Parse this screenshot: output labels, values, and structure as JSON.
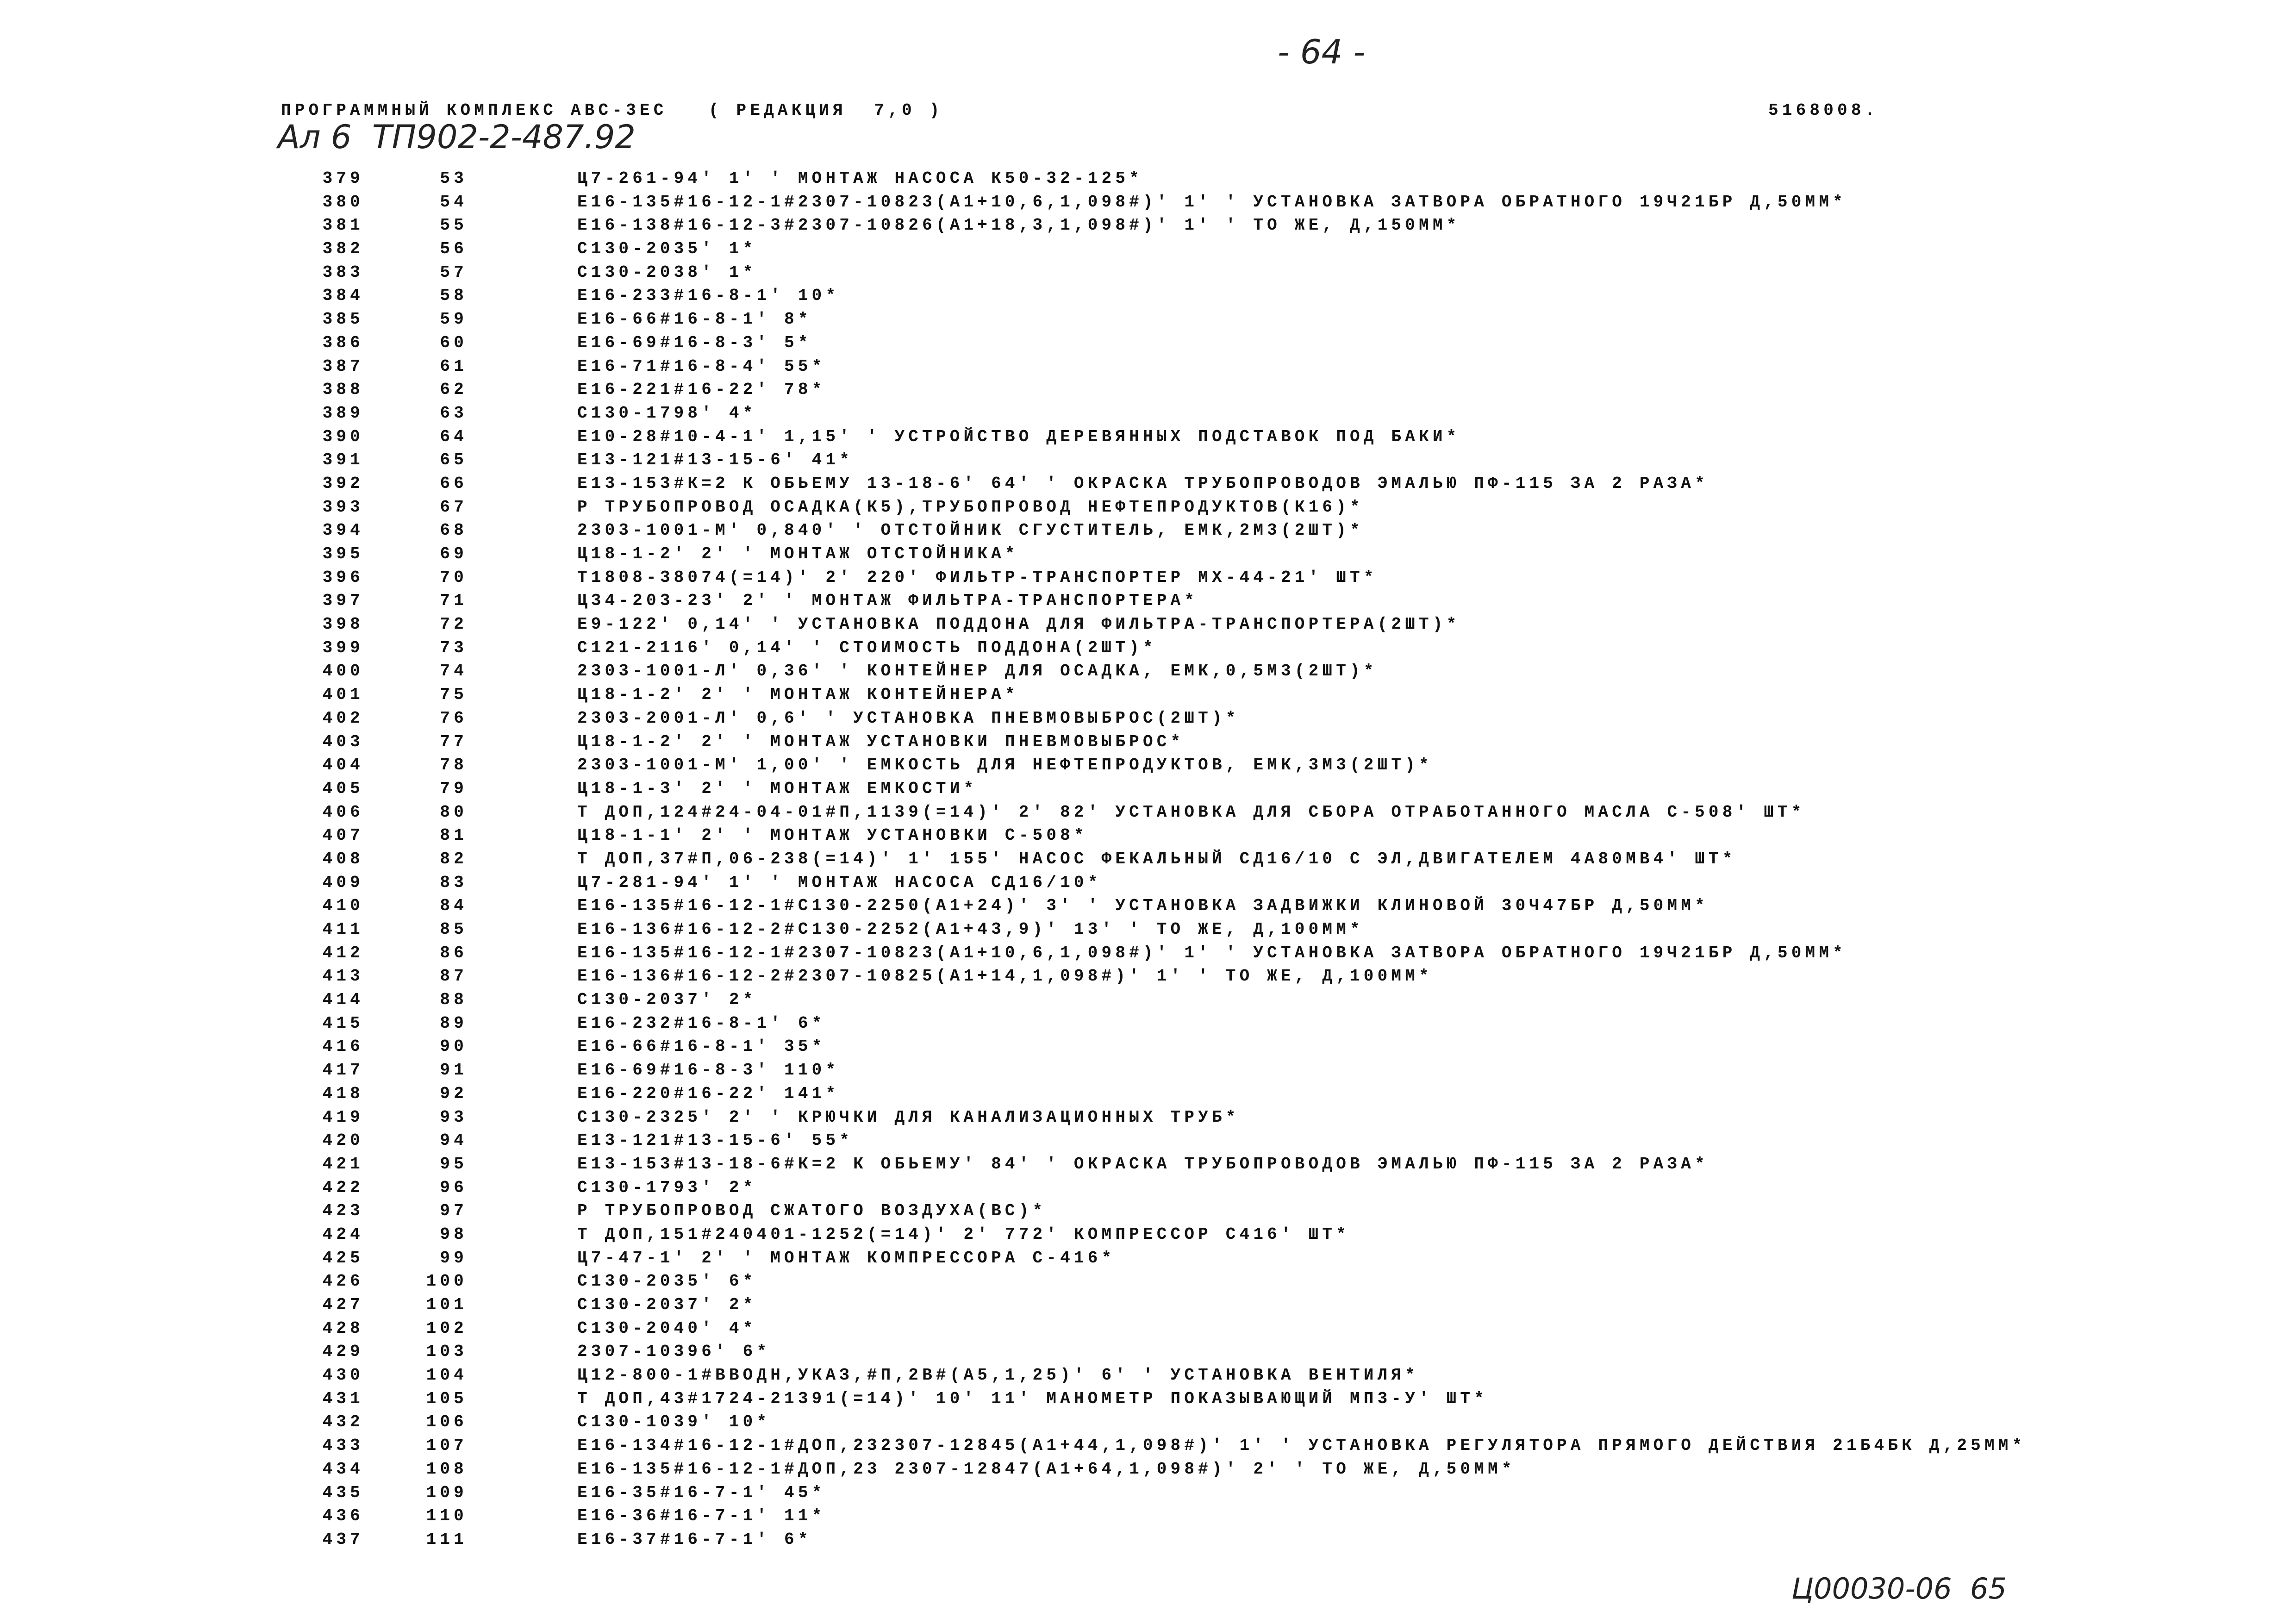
{
  "page_number": "- 64 -",
  "header": {
    "title": "ПРОГРАММНЫЙ КОМПЛЕКС АВС-3ЕС   ( РЕДАКЦИЯ  7,0 )",
    "code": "5168008."
  },
  "handwritten_note": "Ал 6  ТП902-2-487.92",
  "rows": [
    [
      "379",
      "53",
      "Ц7-261-94' 1' ' МОНТАЖ НАСОСА К50-32-125*"
    ],
    [
      "380",
      "54",
      "Е16-135#16-12-1#2307-10823(А1+10,6,1,098#)' 1' ' УСТАНОВКА ЗАТВОРА ОБРАТНОГО 19Ч21БР Д,50ММ*"
    ],
    [
      "381",
      "55",
      "Е16-138#16-12-3#2307-10826(А1+18,3,1,098#)' 1' ' ТО ЖЕ, Д,150ММ*"
    ],
    [
      "382",
      "56",
      "С130-2035' 1*"
    ],
    [
      "383",
      "57",
      "С130-2038' 1*"
    ],
    [
      "384",
      "58",
      "Е16-233#16-8-1' 10*"
    ],
    [
      "385",
      "59",
      "Е16-66#16-8-1' 8*"
    ],
    [
      "386",
      "60",
      "Е16-69#16-8-3' 5*"
    ],
    [
      "387",
      "61",
      "Е16-71#16-8-4' 55*"
    ],
    [
      "388",
      "62",
      "Е16-221#16-22' 78*"
    ],
    [
      "389",
      "63",
      "С130-1798' 4*"
    ],
    [
      "390",
      "64",
      "Е10-28#10-4-1' 1,15' ' УСТРОЙСТВО ДЕРЕВЯННЫХ ПОДСТАВОК ПОД БАКИ*"
    ],
    [
      "391",
      "65",
      "Е13-121#13-15-6' 41*"
    ],
    [
      "392",
      "66",
      "Е13-153#К=2 К ОБЬЕМУ 13-18-6' 64' ' ОКРАСКА ТРУБОПРОВОДОВ ЭМАЛЬЮ ПФ-115 ЗА 2 РАЗА*"
    ],
    [
      "393",
      "67",
      "Р ТРУБОПРОВОД ОСАДКА(К5),ТРУБОПРОВОД НЕФТЕПРОДУКТОВ(К16)*"
    ],
    [
      "394",
      "68",
      "2303-1001-М' 0,840' ' ОТСТОЙНИК СГУСТИТЕЛЬ, ЕМК,2М3(2ШТ)*"
    ],
    [
      "395",
      "69",
      "Ц18-1-2' 2' ' МОНТАЖ ОТСТОЙНИКА*"
    ],
    [
      "396",
      "70",
      "Т1808-38074(=14)' 2' 220' ФИЛЬТР-ТРАНСПОРТЕР МХ-44-21' ШТ*"
    ],
    [
      "397",
      "71",
      "Ц34-203-23' 2' ' МОНТАЖ ФИЛЬТРА-ТРАНСПОРТЕРА*"
    ],
    [
      "398",
      "72",
      "Е9-122' 0,14' ' УСТАНОВКА ПОДДОНА ДЛЯ ФИЛЬТРА-ТРАНСПОРТЕРА(2ШТ)*"
    ],
    [
      "399",
      "73",
      "С121-2116' 0,14' ' СТОИМОСТЬ ПОДДОНА(2ШТ)*"
    ],
    [
      "400",
      "74",
      "2303-1001-Л' 0,36' ' КОНТЕЙНЕР ДЛЯ ОСАДКА, ЕМК,0,5М3(2ШТ)*"
    ],
    [
      "401",
      "75",
      "Ц18-1-2' 2' ' МОНТАЖ КОНТЕЙНЕРА*"
    ],
    [
      "402",
      "76",
      "2303-2001-Л' 0,6' ' УСТАНОВКА ПНЕВМОВЫБРОС(2ШТ)*"
    ],
    [
      "403",
      "77",
      "Ц18-1-2' 2' ' МОНТАЖ УСТАНОВКИ ПНЕВМОВЫБРОС*"
    ],
    [
      "404",
      "78",
      "2303-1001-М' 1,00' ' ЕМКОСТЬ ДЛЯ НЕФТЕПРОДУКТОВ, ЕМК,3М3(2ШТ)*"
    ],
    [
      "405",
      "79",
      "Ц18-1-3' 2' ' МОНТАЖ ЕМКОСТИ*"
    ],
    [
      "406",
      "80",
      "Т ДОП,124#24-04-01#П,1139(=14)' 2' 82' УСТАНОВКА ДЛЯ СБОРА ОТРАБОТАННОГО МАСЛА С-508' ШТ*"
    ],
    [
      "407",
      "81",
      "Ц18-1-1' 2' ' МОНТАЖ УСТАНОВКИ С-508*"
    ],
    [
      "408",
      "82",
      "Т ДОП,37#П,06-238(=14)' 1' 155' НАСОС ФЕКАЛЬНЫЙ СД16/10 С ЭЛ,ДВИГАТЕЛЕМ 4А80МВ4' ШТ*"
    ],
    [
      "409",
      "83",
      "Ц7-281-94' 1' ' МОНТАЖ НАСОСА СД16/10*"
    ],
    [
      "410",
      "84",
      "Е16-135#16-12-1#С130-2250(А1+24)' 3' ' УСТАНОВКА ЗАДВИЖКИ КЛИНОВОЙ 30Ч47БР Д,50ММ*"
    ],
    [
      "411",
      "85",
      "Е16-136#16-12-2#С130-2252(А1+43,9)' 13' ' ТО ЖЕ, Д,100ММ*"
    ],
    [
      "412",
      "86",
      "Е16-135#16-12-1#2307-10823(А1+10,6,1,098#)' 1' ' УСТАНОВКА ЗАТВОРА ОБРАТНОГО 19Ч21БР Д,50ММ*"
    ],
    [
      "413",
      "87",
      "Е16-136#16-12-2#2307-10825(А1+14,1,098#)' 1' ' ТО ЖЕ, Д,100ММ*"
    ],
    [
      "414",
      "88",
      "С130-2037' 2*"
    ],
    [
      "415",
      "89",
      "Е16-232#16-8-1' 6*"
    ],
    [
      "416",
      "90",
      "Е16-66#16-8-1' 35*"
    ],
    [
      "417",
      "91",
      "Е16-69#16-8-3' 110*"
    ],
    [
      "418",
      "92",
      "Е16-220#16-22' 141*"
    ],
    [
      "419",
      "93",
      "С130-2325' 2' ' КРЮЧКИ ДЛЯ КАНАЛИЗАЦИОННЫХ ТРУБ*"
    ],
    [
      "420",
      "94",
      "Е13-121#13-15-6' 55*"
    ],
    [
      "421",
      "95",
      "Е13-153#13-18-6#К=2 К ОБЬЕМУ' 84' ' ОКРАСКА ТРУБОПРОВОДОВ ЭМАЛЬЮ ПФ-115 ЗА 2 РАЗА*"
    ],
    [
      "422",
      "96",
      "С130-1793' 2*"
    ],
    [
      "423",
      "97",
      "Р ТРУБОПРОВОД СЖАТОГО ВОЗДУХА(ВС)*"
    ],
    [
      "424",
      "98",
      "Т ДОП,151#240401-1252(=14)' 2' 772' КОМПРЕССОР С416' ШТ*"
    ],
    [
      "425",
      "99",
      "Ц7-47-1' 2' ' МОНТАЖ КОМПРЕССОРА С-416*"
    ],
    [
      "426",
      "100",
      "С130-2035' 6*"
    ],
    [
      "427",
      "101",
      "С130-2037' 2*"
    ],
    [
      "428",
      "102",
      "С130-2040' 4*"
    ],
    [
      "429",
      "103",
      "2307-10396' 6*"
    ],
    [
      "430",
      "104",
      "Ц12-800-1#ВВОДН,УКАЗ,#П,2В#(А5,1,25)' 6' ' УСТАНОВКА ВЕНТИЛЯ*"
    ],
    [
      "431",
      "105",
      "Т ДОП,43#1724-21391(=14)' 10' 11' МАНОМЕТР ПОКАЗЫВАЮЩИЙ МП3-У' ШТ*"
    ],
    [
      "432",
      "106",
      "С130-1039' 10*"
    ],
    [
      "433",
      "107",
      "Е16-134#16-12-1#ДОП,232307-12845(А1+44,1,098#)' 1' ' УСТАНОВКА РЕГУЛЯТОРА ПРЯМОГО ДЕЙСТВИЯ 21Б4БК Д,25ММ*"
    ],
    [
      "434",
      "108",
      "Е16-135#16-12-1#ДОП,23 2307-12847(А1+64,1,098#)' 2' ' ТО ЖЕ, Д,50ММ*"
    ],
    [
      "435",
      "109",
      "Е16-35#16-7-1' 45*"
    ],
    [
      "436",
      "110",
      "Е16-36#16-7-1' 11*"
    ],
    [
      "437",
      "111",
      "Е16-37#16-7-1' 6*"
    ]
  ],
  "footer_note": "Ц00030-06  65"
}
